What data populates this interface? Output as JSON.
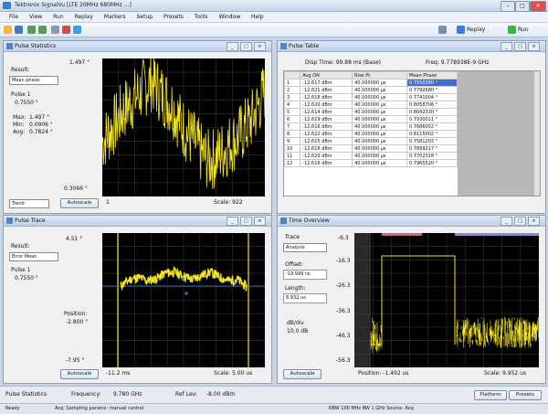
{
  "app": {
    "title": "Tektronix SignalVu  [LTE 20MHz 680MHz ...]"
  },
  "menu": [
    "File",
    "View",
    "Run",
    "Replay",
    "Markers",
    "Setup",
    "Presets",
    "Tools",
    "Window",
    "Help"
  ],
  "toolbar": {
    "replay_label": "Replay",
    "run_label": "Run"
  },
  "panels": {
    "stats": {
      "title": "Pulse Statistics",
      "top_value": "1.497 °",
      "result_label": "Result:",
      "result_value": "Mean phase",
      "pulse_label": "Pulse 1",
      "pulse_value": "0.7550 °",
      "max_label": "Max:",
      "max_value": "1.497 °",
      "min_label": "Min:",
      "min_value": "0.0906 °",
      "avg_label": "Avg:",
      "avg_value": "0.7824 °",
      "bottom_value": "0.3066 °",
      "trend_value": "Trend",
      "autoscale": "Autoscale",
      "x_value": "1",
      "scale_label": "Scale: 922"
    },
    "table": {
      "title": "Pulse Table",
      "display_from": "Disp Time:  99.88 ms (Base)",
      "freq_info": "Freq: 9.778938E-9 GHz",
      "columns": [
        "",
        "Avg ON",
        "Rise Pt",
        "Mean Phase"
      ],
      "rows": [
        [
          "1",
          "-12.617 dBm",
          "40.000000 μs",
          "0.7550360 °"
        ],
        [
          "2",
          "-12.621 dBm",
          "40.000000 μs",
          "0.7792680 °"
        ],
        [
          "3",
          "-12.618 dBm",
          "40.000000 μs",
          "0.7741004 °"
        ],
        [
          "4",
          "-12.620 dBm",
          "40.000000 μs",
          "0.8058706 °"
        ],
        [
          "5",
          "-12.614 dBm",
          "40.000000 μs",
          "0.8042330 °"
        ],
        [
          "6",
          "-12.619 dBm",
          "40.000000 μs",
          "0.7930011 °"
        ],
        [
          "7",
          "-12.616 dBm",
          "40.000000 μs",
          "0.7686052 °"
        ],
        [
          "8",
          "-12.622 dBm",
          "40.000000 μs",
          "0.8115002 °"
        ],
        [
          "9",
          "-12.615 dBm",
          "40.000000 μs",
          "0.7581203 °"
        ],
        [
          "10",
          "-12.618 dBm",
          "40.000000 μs",
          "0.7899217 °"
        ],
        [
          "11",
          "-12.620 dBm",
          "40.000000 μs",
          "0.7702318 °"
        ],
        [
          "12",
          "-12.616 dBm",
          "40.000000 μs",
          "0.7965520 °"
        ]
      ]
    },
    "trace": {
      "title": "Pulse Trace",
      "top_value": "4.51 °",
      "result_label": "Result:",
      "result_value": "Error Mean",
      "pulse_label": "Pulse 1",
      "pulse_value": "0.7550 °",
      "position_label": "Position:",
      "position_value": "-2.800 °",
      "bottom_value": "-7.95 °",
      "autoscale": "Autoscale",
      "x_value": "-11.2 ms",
      "scale_label": "Scale: 5.00 us"
    },
    "time": {
      "title": "Time Overview",
      "trace_label": "Trace",
      "trace_value": "Analysis",
      "offset_label": "Offset:",
      "offset_value": "-19.999 ns",
      "length_label": "Length:",
      "length_value": "8.932 us",
      "dbdiv_label": "dB/div",
      "dbdiv_value": "10.0 dB",
      "y_ticks": [
        "-6.3",
        "-16.3",
        "-26.3",
        "-36.3",
        "-46.3",
        "-56.3"
      ],
      "autoscale": "Autoscale",
      "x_value": "Position: -1.492 us",
      "scale_label": "Scale: 9.952 us"
    }
  },
  "status": {
    "left": "Pulse Statistics",
    "freq_label": "Frequency:",
    "freq_value": "9.780 GHz",
    "ref_label": "Ref Lev:",
    "ref_value": "-8.00 dBm",
    "platform": "Platform",
    "presets": "Presets"
  },
  "bottombar": {
    "left": "Ready",
    "mid": "Acq: Sampling params: manual control",
    "right": "RBW 100 MHz  BW 1 GHz   Source: Acq   "
  },
  "colors": {
    "trace": "#f2e324",
    "accent": "#3f6fd0",
    "plot_bg": "#000000"
  },
  "chart_data": [
    {
      "type": "line",
      "title": "",
      "xlabel": "",
      "ylabel": "",
      "ylim": [
        0.3066,
        1.497
      ],
      "series": [
        {
          "name": "",
          "values": [
            0.78,
            0.86,
            0.95,
            1.05,
            1.12,
            1.18,
            1.25,
            1.31,
            1.22,
            1.15,
            1.08,
            0.95,
            0.85,
            0.78,
            0.68,
            0.62,
            0.64,
            0.7,
            0.76,
            0.8,
            0.88,
            0.95,
            1.08,
            1.22
          ]
        }
      ]
    },
    {
      "type": "line",
      "title": "",
      "xlabel": "",
      "ylabel": "",
      "ylim": [
        -7.95,
        4.51
      ],
      "series": [
        {
          "name": "",
          "values": [
            -0.4,
            0.2,
            0.4,
            0.1,
            0.3,
            0.8,
            0.9,
            0.5,
            0.2,
            0.6,
            0.9,
            0.4,
            0.1,
            0.2,
            -0.5
          ]
        }
      ]
    }
  ]
}
